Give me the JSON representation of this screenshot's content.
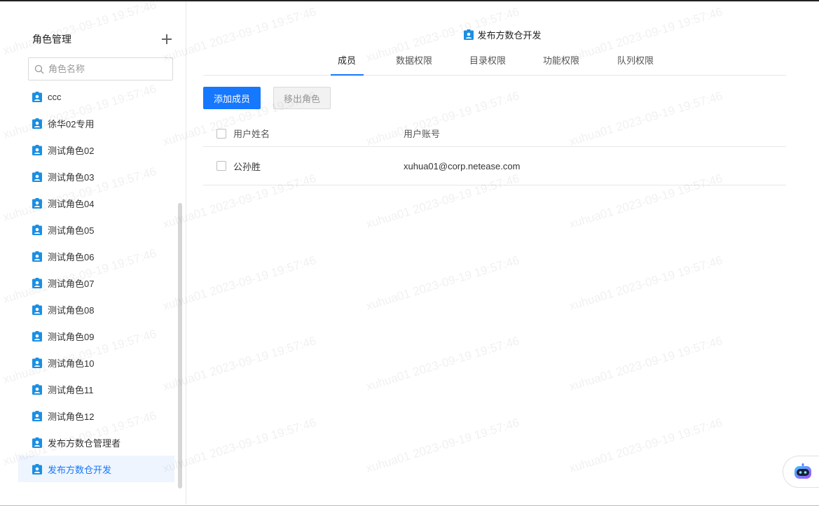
{
  "sidebar": {
    "title": "角色管理",
    "search_placeholder": "角色名称",
    "items": [
      {
        "label": "ccc"
      },
      {
        "label": "徐华02专用"
      },
      {
        "label": "测试角色02"
      },
      {
        "label": "测试角色03"
      },
      {
        "label": "测试角色04"
      },
      {
        "label": "测试角色05"
      },
      {
        "label": "测试角色06"
      },
      {
        "label": "测试角色07"
      },
      {
        "label": "测试角色08"
      },
      {
        "label": "测试角色09"
      },
      {
        "label": "测试角色10"
      },
      {
        "label": "测试角色11"
      },
      {
        "label": "测试角色12"
      },
      {
        "label": "发布方数仓管理者"
      },
      {
        "label": "发布方数仓开发",
        "active": true
      }
    ]
  },
  "main": {
    "role_title": "发布方数仓开发",
    "tabs": [
      {
        "label": "成员",
        "active": true
      },
      {
        "label": "数据权限"
      },
      {
        "label": "目录权限"
      },
      {
        "label": "功能权限"
      },
      {
        "label": "队列权限"
      }
    ],
    "buttons": {
      "add_member": "添加成员",
      "remove_role": "移出角色"
    },
    "table": {
      "columns": [
        "用户姓名",
        "用户账号"
      ],
      "rows": [
        {
          "name": "公孙胜",
          "account": "xuhua01@corp.netease.com"
        }
      ]
    }
  },
  "watermark": "xuhua01 2023-09-19 19:57:46",
  "colors": {
    "accent": "#1677ff",
    "active_bg": "#eef5fe",
    "role_icon": "#1a8fe3"
  },
  "icons": {
    "role": "person-badge-icon",
    "search": "search-icon",
    "add": "plus-icon",
    "assistant": "robot-icon"
  }
}
